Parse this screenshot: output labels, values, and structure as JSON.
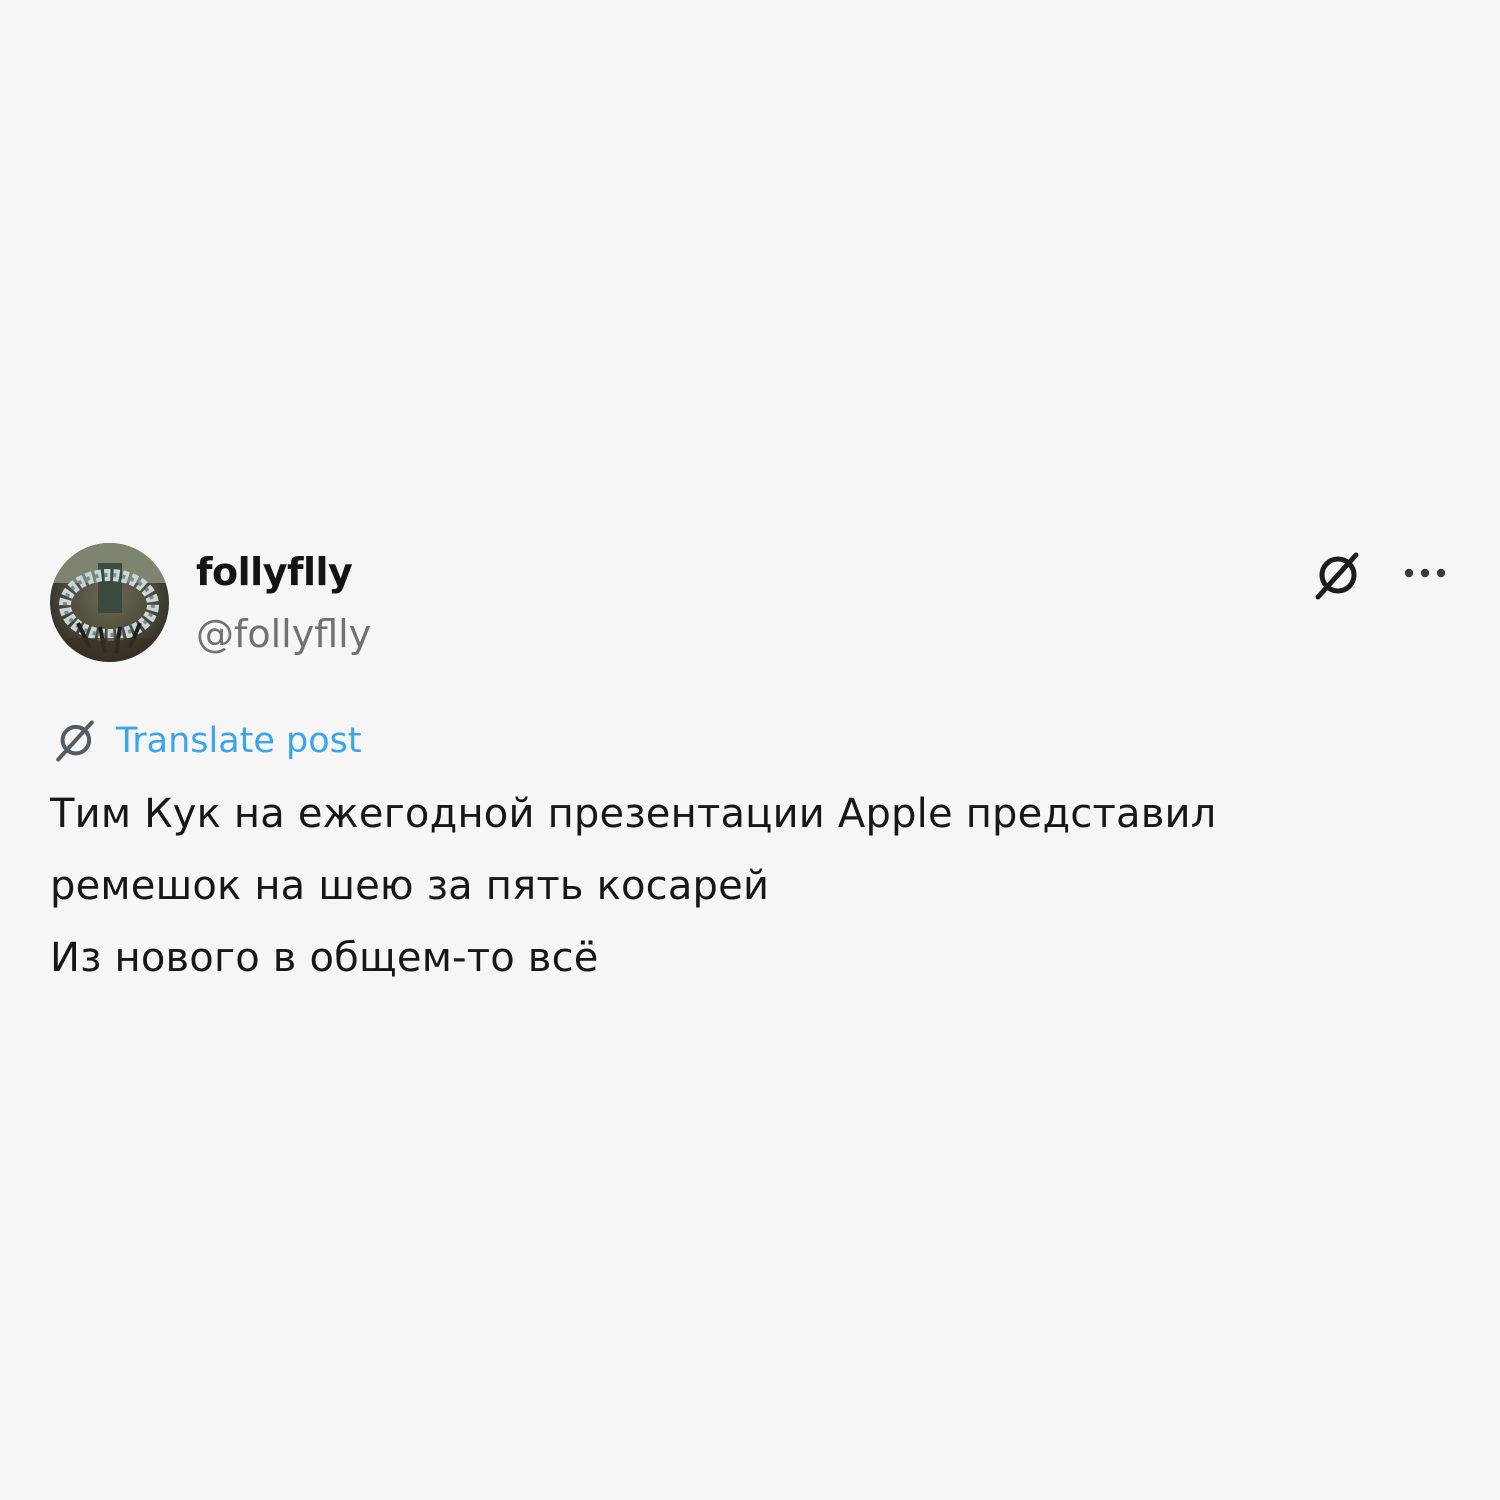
{
  "author": {
    "display_name": "follyflly",
    "handle": "@follyflly",
    "avatar_icon": "avatar-photo"
  },
  "actions": {
    "grok_icon": "grok-slash-icon",
    "more_icon": "ellipsis-icon"
  },
  "translate": {
    "label": "Translate post",
    "icon": "grok-slash-icon",
    "color": "#3aa4ee"
  },
  "post": {
    "lines": [
      "Тим Кук на ежегодной презентации Apple представил",
      "ремешок на шею за пять косарей",
      "Из нового в общем-то всё"
    ]
  },
  "colors": {
    "background": "#f6f6f6",
    "text": "#171717",
    "muted": "#717171",
    "accent": "#3aa4ee"
  }
}
